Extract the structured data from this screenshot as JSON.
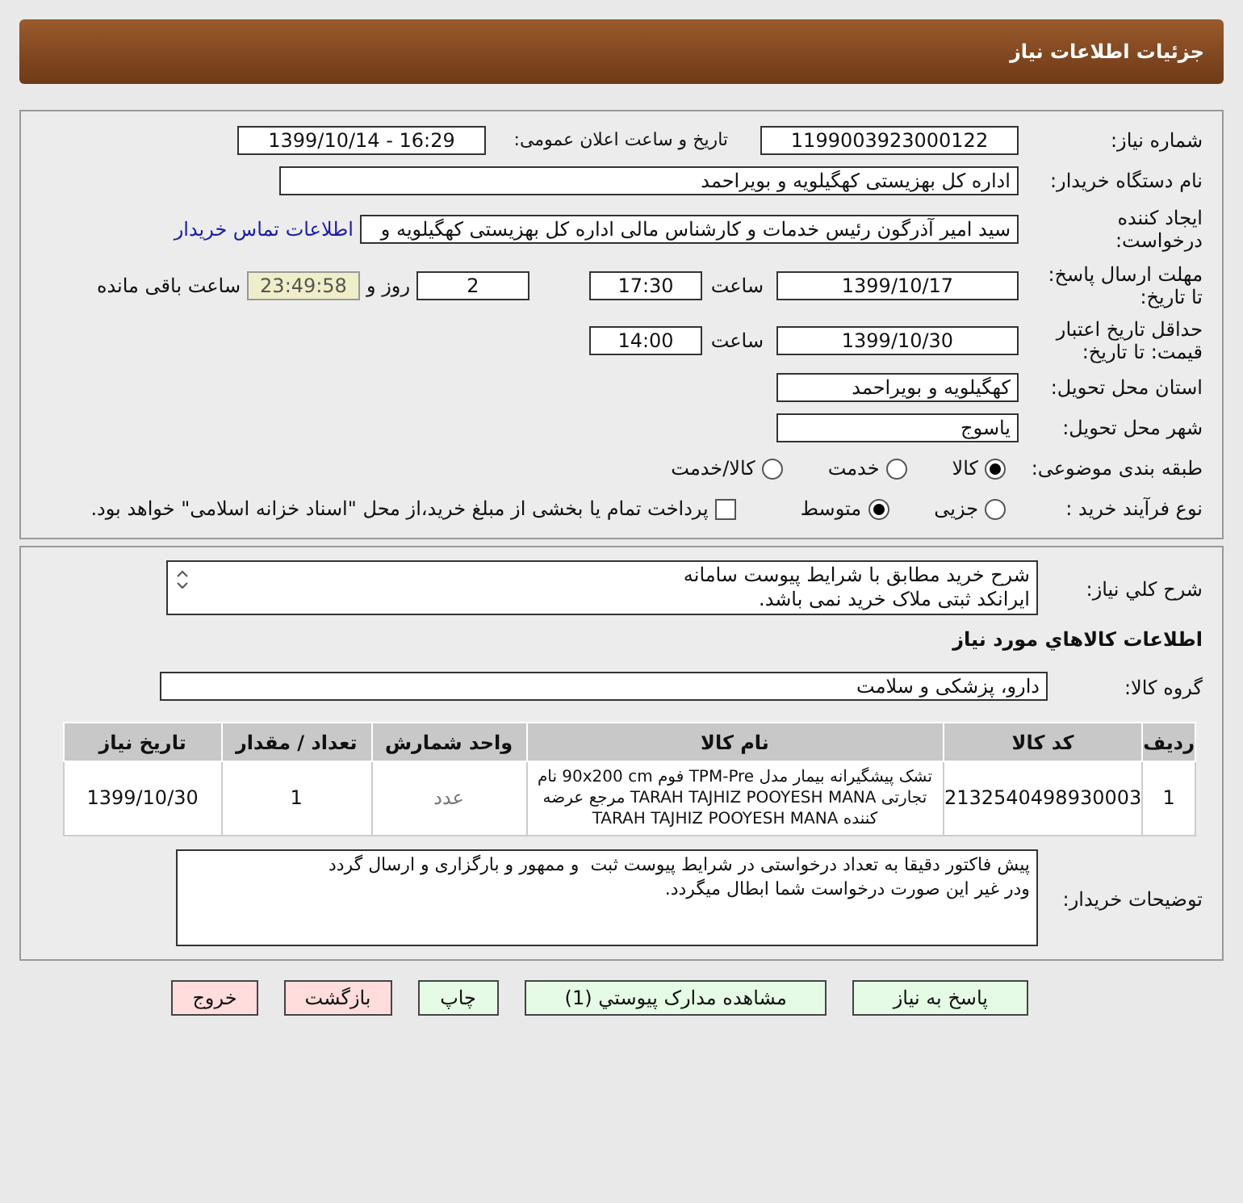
{
  "header": {
    "title": "جزئیات اطلاعات نیاز"
  },
  "need_number": {
    "label": "شماره نیاز:",
    "value": "1199003923000122"
  },
  "announce": {
    "label": "تاریخ و ساعت اعلان عمومی:",
    "value": "1399/10/14 - 16:29"
  },
  "buyer_org": {
    "label": "نام دستگاه خریدار:",
    "value": "اداره کل بهزیستی کهگیلویه و بویراحمد"
  },
  "requester": {
    "label_lines": [
      "ایجاد کننده",
      "درخواست:"
    ],
    "value": "سید امیر آذرگون رئیس خدمات و کارشناس مالی اداره کل بهزیستی کهگیلویه و",
    "link": "اطلاعات تماس خریدار"
  },
  "reply_deadline": {
    "label_lines": [
      "مهلت ارسال پاسخ:",
      "تا تاریخ:"
    ],
    "date": "1399/10/17",
    "time_label": "ساعت",
    "time": "17:30",
    "days": "2",
    "days_label": "روز و",
    "remaining": "23:49:58",
    "remaining_label": "ساعت باقی مانده"
  },
  "price_validity": {
    "label_lines": [
      "حداقل تاریخ اعتبار",
      "قیمت: تا تاریخ:"
    ],
    "date": "1399/10/30",
    "time_label": "ساعت",
    "time": "14:00"
  },
  "province": {
    "label": "استان محل تحویل:",
    "value": "کهگیلویه و بویراحمد"
  },
  "city": {
    "label": "شهر محل تحویل:",
    "value": "یاسوج"
  },
  "category": {
    "label": "طبقه بندی موضوعی:",
    "options": [
      {
        "label": "کالا",
        "selected": true
      },
      {
        "label": "خدمت",
        "selected": false
      },
      {
        "label": "کالا/خدمت",
        "selected": false
      }
    ]
  },
  "process": {
    "label": "نوع فرآیند خرید :",
    "options": [
      {
        "label": "جزیی",
        "selected": false
      },
      {
        "label": "متوسط",
        "selected": true
      }
    ],
    "payment": {
      "label": "پرداخت تمام یا بخشی از مبلغ خرید،از محل \"اسناد خزانه اسلامی\" خواهد بود.",
      "checked": false
    }
  },
  "description": {
    "label": "شرح کلي نياز:",
    "lines": [
      "شرح خرید مطابق با شرایط پیوست سامانه",
      "ایرانکد ثبتی ملاک خرید نمی باشد."
    ]
  },
  "goods_title": "اطلاعات کالاهاي مورد نياز",
  "goods_group": {
    "label": "گروه کالا:",
    "value": "دارو، پزشکی و سلامت"
  },
  "table": {
    "columns": [
      "ردیف",
      "کد کالا",
      "نام کالا",
      "واحد شمارش",
      "تعداد / مقدار",
      "تاریخ نیاز"
    ],
    "rows": [
      {
        "cells": [
          "1",
          "2132540498930003",
          "تشک پیشگیرانه بیمار مدل TPM-Pre فوم 90x200 cm نام تجارتی TARAH TAJHIZ POOYESH MANA مرجع عرضه کننده TARAH TAJHIZ POOYESH MANA",
          "عدد",
          "1",
          "1399/10/30"
        ]
      }
    ]
  },
  "buyer_notes": {
    "label": "توضیحات خریدار:",
    "lines": [
      "پیش فاکتور دقیقا به تعداد درخواستی در شرایط پیوست ثبت  و ممهور و بارگزاری و ارسال گردد",
      "ودر غیر این صورت درخواست شما ابطال میگردد."
    ]
  },
  "buttons": [
    {
      "label": "پاسخ به نیاز",
      "kind": "green"
    },
    {
      "label": "مشاهده مدارک پیوستي (1)",
      "kind": "green"
    },
    {
      "label": "چاپ",
      "kind": "green"
    },
    {
      "label": "بازگشت",
      "kind": "red"
    },
    {
      "label": "خروج",
      "kind": "red"
    }
  ]
}
